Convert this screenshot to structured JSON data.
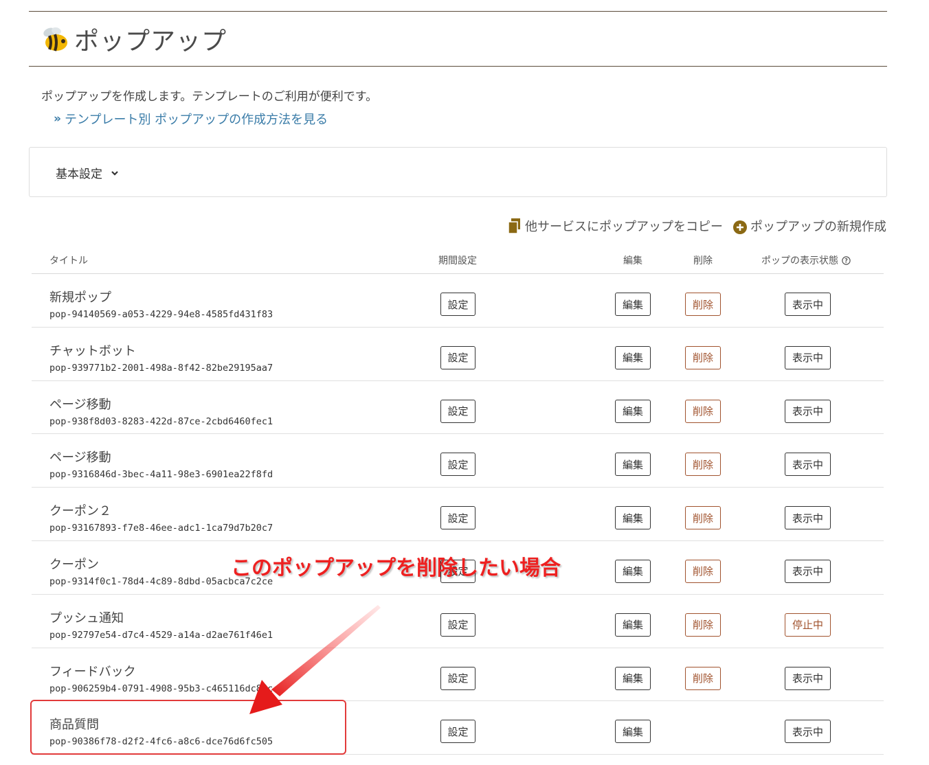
{
  "header": {
    "title": "ポップアップ",
    "logo_icon": "bee-icon"
  },
  "intro": {
    "description": "ポップアップを作成します。テンプレートのご利用が便利です。",
    "howto_link": "テンプレート別 ポップアップの作成方法を見る"
  },
  "basic_settings": {
    "label": "基本設定"
  },
  "actions": {
    "copy_label": "他サービスにポップアップをコピー",
    "new_label": "ポップアップの新規作成"
  },
  "table": {
    "headers": {
      "title": "タイトル",
      "period": "期間設定",
      "edit": "編集",
      "delete": "削除",
      "status": "ポップの表示状態"
    },
    "rows": [
      {
        "title": "新規ポップ",
        "id": "pop-94140569-a053-4229-94e8-4585fd431f83",
        "period": "設定",
        "edit": "編集",
        "delete": "削除",
        "status": "表示中"
      },
      {
        "title": "チャットボット",
        "id": "pop-939771b2-2001-498a-8f42-82be29195aa7",
        "period": "設定",
        "edit": "編集",
        "delete": "削除",
        "status": "表示中"
      },
      {
        "title": "ページ移動",
        "id": "pop-938f8d03-8283-422d-87ce-2cbd6460fec1",
        "period": "設定",
        "edit": "編集",
        "delete": "削除",
        "status": "表示中"
      },
      {
        "title": "ページ移動",
        "id": "pop-9316846d-3bec-4a11-98e3-6901ea22f8fd",
        "period": "設定",
        "edit": "編集",
        "delete": "削除",
        "status": "表示中"
      },
      {
        "title": "クーポン２",
        "id": "pop-93167893-f7e8-46ee-adc1-1ca79d7b20c7",
        "period": "設定",
        "edit": "編集",
        "delete": "削除",
        "status": "表示中"
      },
      {
        "title": "クーポン",
        "id": "pop-9314f0c1-78d4-4c89-8dbd-05acbca7c2ce",
        "period": "設定",
        "edit": "編集",
        "delete": "削除",
        "status": "表示中"
      },
      {
        "title": "プッシュ通知",
        "id": "pop-92797e54-d7c4-4529-a14a-d2ae761f46e1",
        "period": "設定",
        "edit": "編集",
        "delete": "削除",
        "status": "停止中"
      },
      {
        "title": "フィードバック",
        "id": "pop-906259b4-0791-4908-95b3-c465116dc85c",
        "period": "設定",
        "edit": "編集",
        "delete": "削除",
        "status": "表示中"
      },
      {
        "title": "商品質問",
        "id": "pop-90386f78-d2f2-4fc6-a8c6-dce76d6fc505",
        "period": "設定",
        "edit": "編集",
        "delete": "",
        "status": "表示中"
      }
    ]
  },
  "annotation": {
    "text": "このポップアップを削除したい場合"
  },
  "colors": {
    "accent": "#8b6914",
    "link": "#3a7ca8",
    "danger": "#a0522d",
    "annotation": "#ee2020"
  }
}
